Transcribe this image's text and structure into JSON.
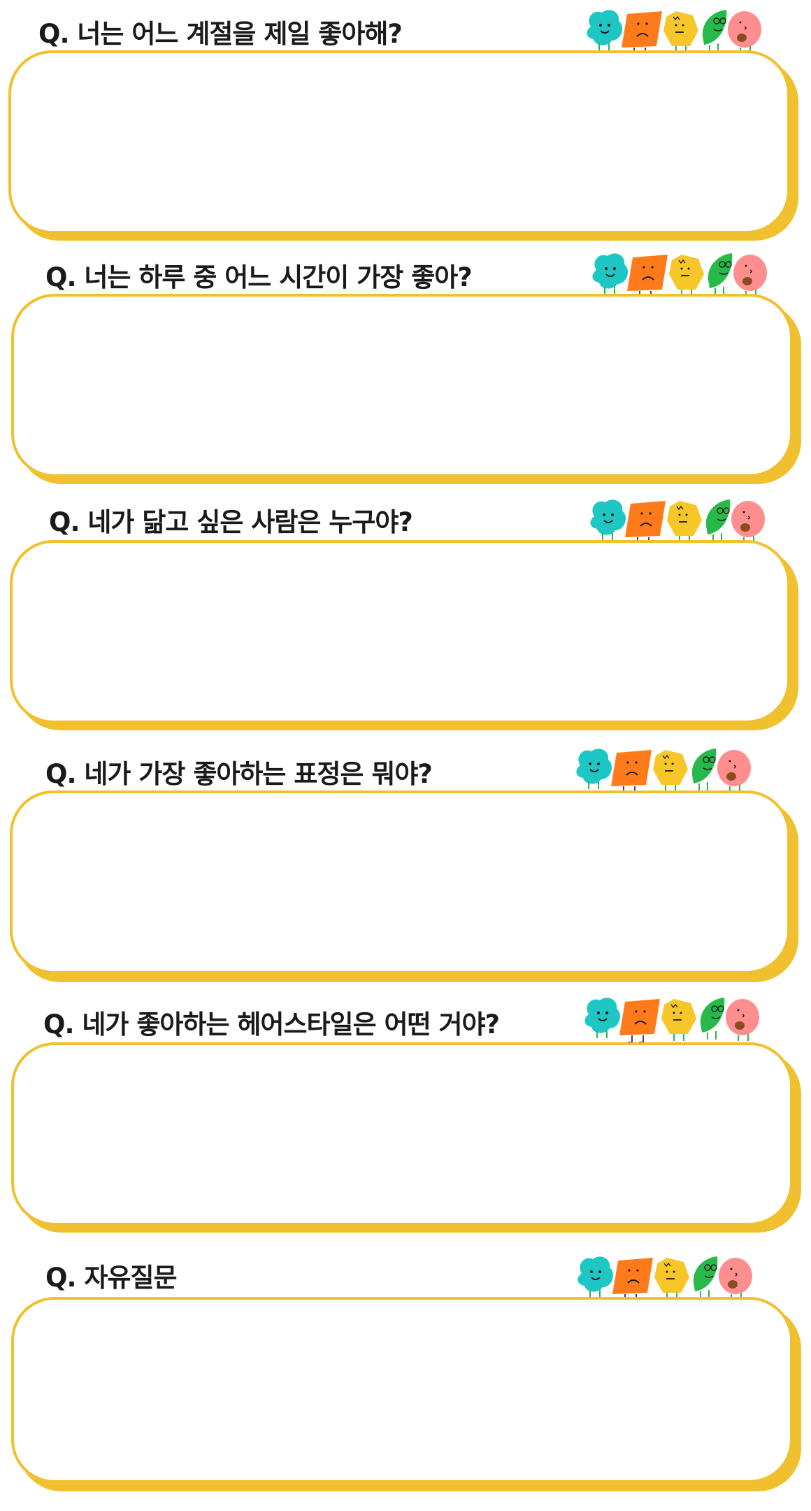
{
  "colors": {
    "accent": "#f0c02e",
    "teal": "#1ec6c4",
    "orange": "#ff7a1a",
    "yellow": "#f7c628",
    "green": "#27b94a",
    "pink": "#ff8f8f"
  },
  "mascot_icons": [
    "teal-blob-icon",
    "orange-square-icon",
    "yellow-hexagon-icon",
    "green-leaf-icon",
    "pink-blob-icon"
  ],
  "questions": [
    {
      "label": "Q. 너는 어느 계절을 제일 좋아해?",
      "answer": ""
    },
    {
      "label": "Q. 너는 하루 중 어느 시간이 가장 좋아?",
      "answer": ""
    },
    {
      "label": "Q. 네가 닮고 싶은 사람은 누구야?",
      "answer": ""
    },
    {
      "label": "Q. 네가 가장 좋아하는 표정은 뭐야?",
      "answer": ""
    },
    {
      "label": "Q. 네가 좋아하는 헤어스타일은 어떤 거야?",
      "answer": ""
    },
    {
      "label": "Q. 자유질문",
      "answer": ""
    }
  ]
}
